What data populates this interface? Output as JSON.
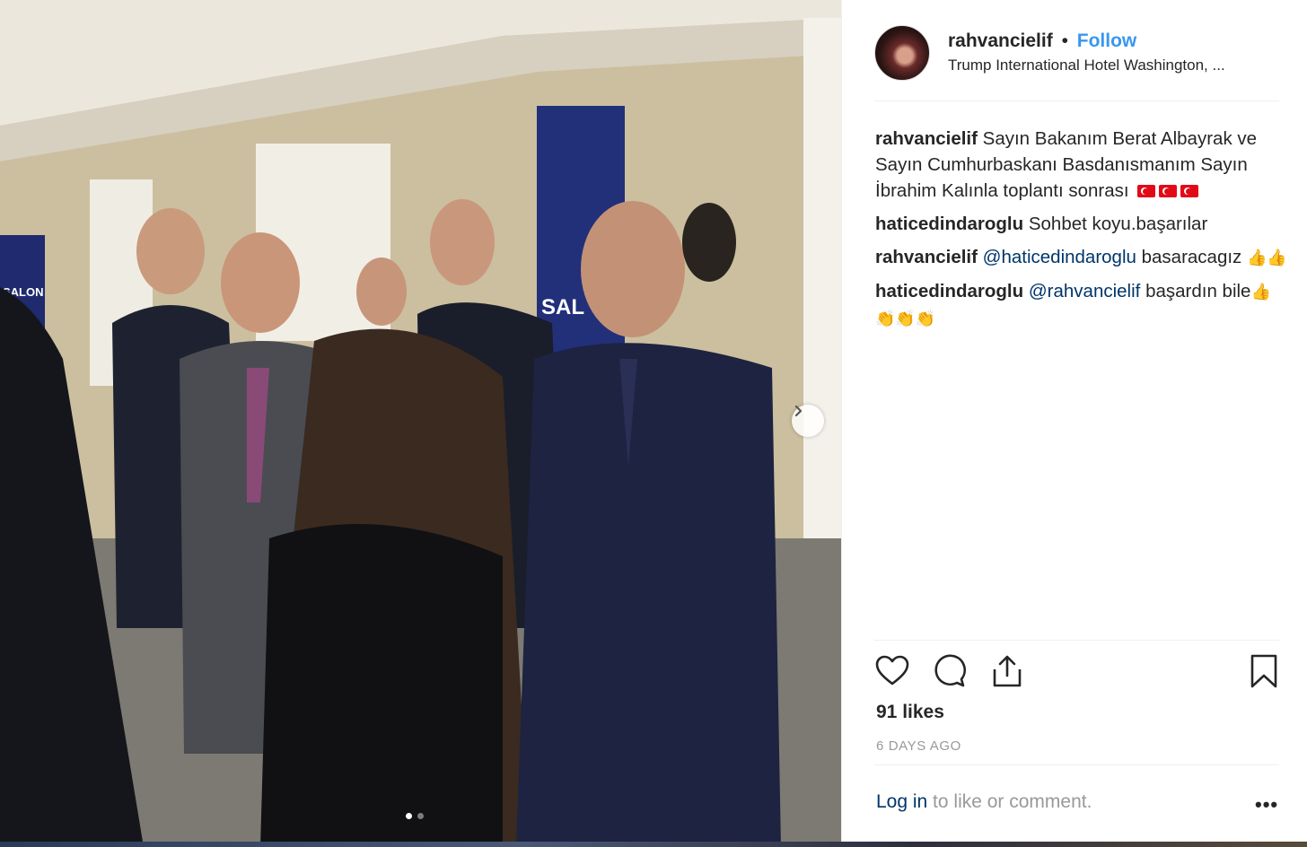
{
  "post": {
    "username": "rahvancielif",
    "bullet": "•",
    "follow_label": "Follow",
    "location": "Trump International Hotel Washington, ..."
  },
  "photo": {
    "banner_left_text": "SALON",
    "banner_right_text": "SAL"
  },
  "comments": [
    {
      "user": "rahvancielif",
      "text": "Sayın Bakanım Berat Albayrak ve Sayın Cumhurbaskanı Basdanısmanım Sayın İbrahim Kalınla toplantı sonrası",
      "flags": 3
    },
    {
      "user": "haticedindaroglu",
      "text": "Sohbet koyu.başarılar"
    },
    {
      "user": "rahvancielif",
      "mention": "@haticedindaroglu",
      "text": "basaracagız",
      "emoji": "👍👍"
    },
    {
      "user": "haticedindaroglu",
      "mention": "@rahvancielif",
      "text": "başardın bile",
      "emoji": "👍👏👏👏"
    }
  ],
  "stats": {
    "likes": "91 likes",
    "date": "6 DAYS AGO"
  },
  "footer": {
    "login_label": "Log in",
    "login_suffix": " to like or comment.",
    "more": "•••"
  },
  "icons": {
    "like": "heart-icon",
    "comment": "comment-bubble-icon",
    "share": "share-icon",
    "save": "bookmark-icon",
    "next": "chevron-right-icon"
  },
  "colors": {
    "link_blue": "#3897f0",
    "mention_blue": "#003569",
    "muted": "#999999",
    "text": "#262626"
  },
  "carousel": {
    "total": 2,
    "active": 1
  }
}
